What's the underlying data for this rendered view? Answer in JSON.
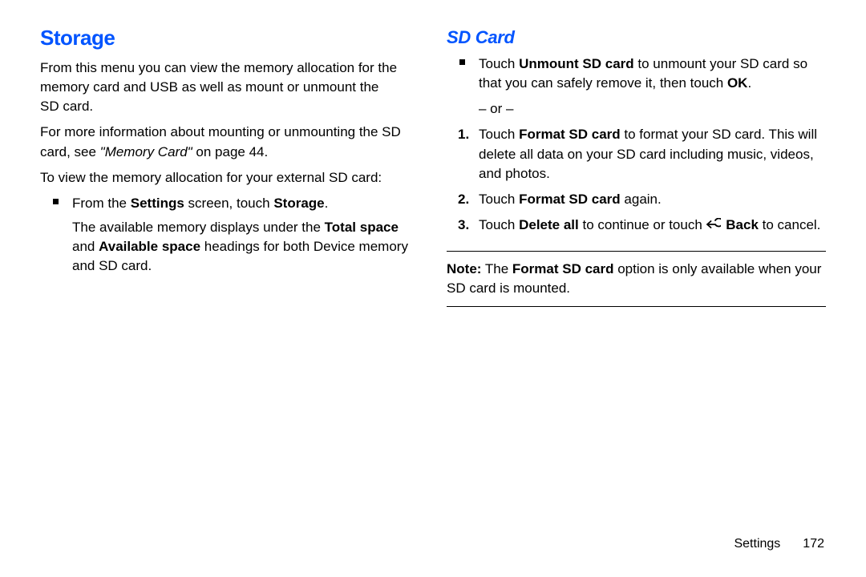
{
  "left": {
    "heading": "Storage",
    "p1": "From this menu you can view the memory allocation for the memory card and USB as well as mount or unmount the SD card.",
    "p2_a": "For more information about mounting or unmounting the SD card, see ",
    "p2_i": "\"Memory Card\"",
    "p2_b": " on page 44.",
    "p3": "To view the memory allocation for your external SD card:",
    "li_a": "From the ",
    "li_b1": "Settings",
    "li_c": " screen, touch ",
    "li_b2": "Storage",
    "li_d": ".",
    "sub_a": "The available memory displays under the ",
    "sub_b1": "Total space",
    "sub_c": " and ",
    "sub_b2": "Available space",
    "sub_d": " headings for both Device memory and SD card."
  },
  "right": {
    "heading": "SD Card",
    "b1_a": "Touch ",
    "b1_b": "Unmount SD card",
    "b1_c": " to unmount your SD card so that you can safely remove it, then touch ",
    "b1_d": "OK",
    "b1_e": ".",
    "or": "– or –",
    "s1_a": "Touch ",
    "s1_b": "Format SD card",
    "s1_c": " to format your SD card. This will delete all data on your SD card including music, videos, and photos.",
    "s2_a": "Touch ",
    "s2_b": "Format SD card",
    "s2_c": " again.",
    "s3_a": "Touch ",
    "s3_b": "Delete all",
    "s3_c": " to continue or touch ",
    "s3_d": "Back",
    "s3_e": " to cancel.",
    "note_a": "Note:",
    "note_b": " The ",
    "note_c": "Format SD card",
    "note_d": " option is only available when your SD card is mounted."
  },
  "footer": {
    "section": "Settings",
    "page": "172"
  }
}
